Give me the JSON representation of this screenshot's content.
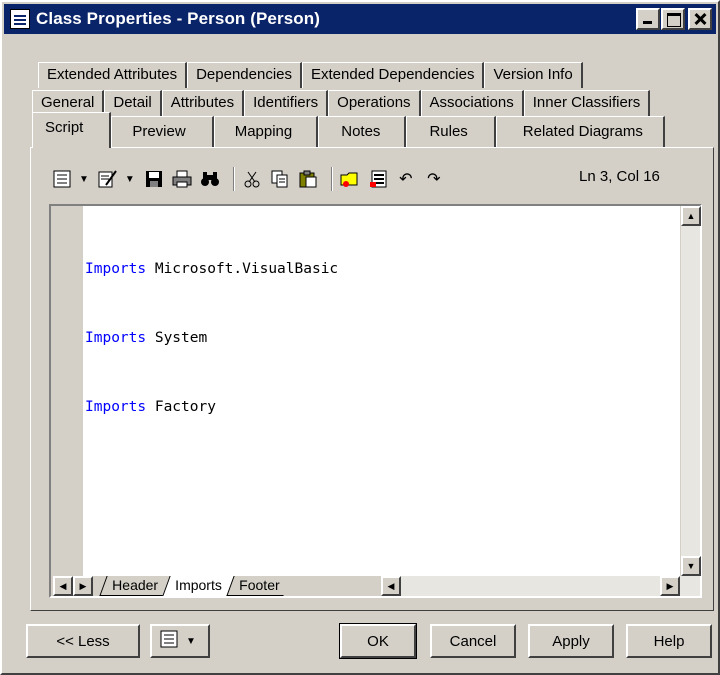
{
  "window": {
    "title": "Class Properties - Person (Person)"
  },
  "tabs": {
    "row1": [
      "Extended Attributes",
      "Dependencies",
      "Extended Dependencies",
      "Version Info"
    ],
    "row2": [
      "General",
      "Detail",
      "Attributes",
      "Identifiers",
      "Operations",
      "Associations",
      "Inner Classifiers"
    ],
    "row3": [
      "Script",
      "Preview",
      "Mapping",
      "Notes",
      "Rules",
      "Related Diagrams"
    ],
    "active": "Script"
  },
  "toolbar": {
    "icons": [
      "properties-icon",
      "edit-icon",
      "save-icon",
      "print-icon",
      "find-icon",
      "cut-icon",
      "copy-icon",
      "paste-icon",
      "open-folder-icon",
      "insert-icon",
      "undo-icon",
      "redo-icon"
    ],
    "position": "Ln 3, Col 16"
  },
  "editor": {
    "lines": [
      {
        "keyword": "Imports",
        "text": " Microsoft.VisualBasic"
      },
      {
        "keyword": "Imports",
        "text": " System"
      },
      {
        "keyword": "Imports",
        "text": " Factory"
      }
    ],
    "sheet_tabs": [
      "Header",
      "Imports",
      "Footer"
    ],
    "active_sheet": "Imports"
  },
  "buttons": {
    "less": "<< Less",
    "ok": "OK",
    "cancel": "Cancel",
    "apply": "Apply",
    "help": "Help"
  },
  "colors": {
    "titlebar": "#0a246a",
    "keyword": "#0000ff",
    "face": "#d4d0c8"
  }
}
